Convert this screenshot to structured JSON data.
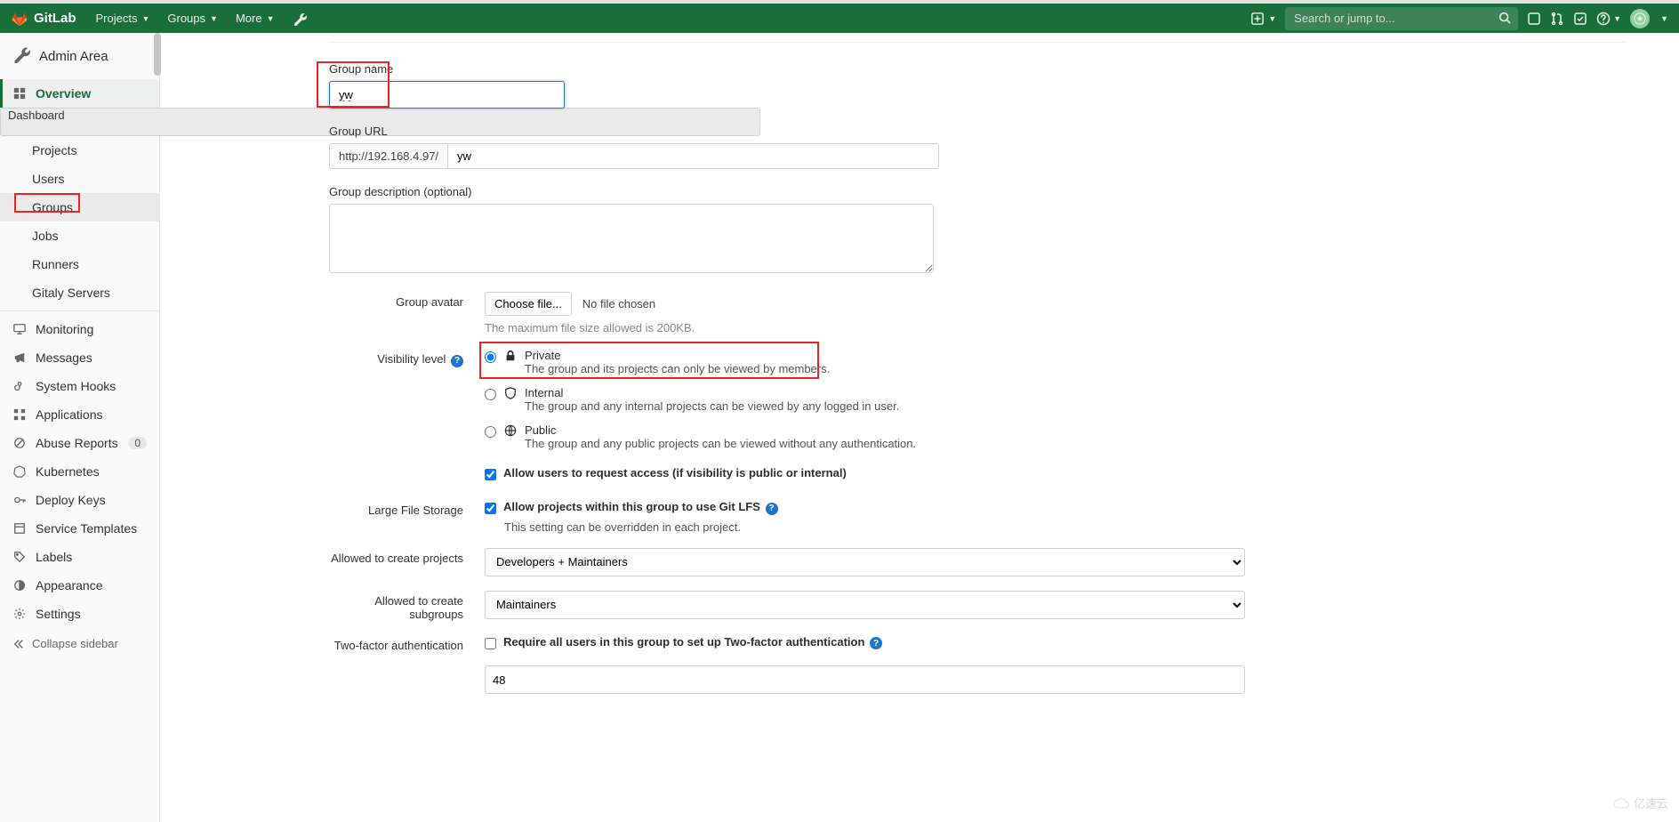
{
  "header": {
    "brand": "GitLab",
    "nav": {
      "projects": "Projects",
      "groups": "Groups",
      "more": "More"
    },
    "search_placeholder": "Search or jump to..."
  },
  "sidebar": {
    "title": "Admin Area",
    "overview": {
      "label": "Overview",
      "subs": {
        "dashboard": "Dashboard",
        "projects": "Projects",
        "users": "Users",
        "groups": "Groups",
        "jobs": "Jobs",
        "runners": "Runners",
        "gitaly": "Gitaly Servers"
      }
    },
    "items": {
      "monitoring": "Monitoring",
      "messages": "Messages",
      "system_hooks": "System Hooks",
      "applications": "Applications",
      "abuse_reports": "Abuse Reports",
      "abuse_count": "0",
      "kubernetes": "Kubernetes",
      "deploy_keys": "Deploy Keys",
      "service_templates": "Service Templates",
      "labels": "Labels",
      "appearance": "Appearance",
      "settings": "Settings"
    },
    "collapse": "Collapse sidebar"
  },
  "form": {
    "group_name_label": "Group name",
    "group_name_value": "yw",
    "group_url_label": "Group URL",
    "group_url_prefix": "http://192.168.4.97/",
    "group_url_value": "yw",
    "desc_label": "Group description (optional)",
    "avatar": {
      "label": "Group avatar",
      "button": "Choose file...",
      "none": "No file chosen",
      "hint": "The maximum file size allowed is 200KB."
    },
    "visibility": {
      "label": "Visibility level",
      "private": {
        "title": "Private",
        "desc": "The group and its projects can only be viewed by members."
      },
      "internal": {
        "title": "Internal",
        "desc": "The group and any internal projects can be viewed by any logged in user."
      },
      "public": {
        "title": "Public",
        "desc": "The group and any public projects can be viewed without any authentication."
      },
      "allow_access": "Allow users to request access (if visibility is public or internal)"
    },
    "lfs": {
      "label": "Large File Storage",
      "check": "Allow projects within this group to use Git LFS",
      "hint": "This setting can be overridden in each project."
    },
    "allowed_projects": {
      "label": "Allowed to create projects",
      "value": "Developers + Maintainers"
    },
    "allowed_subgroups": {
      "label": "Allowed to create subgroups",
      "value": "Maintainers"
    },
    "twofa": {
      "label": "Two-factor authentication",
      "check": "Require all users in this group to set up Two-factor authentication",
      "value": "48"
    }
  },
  "watermark": "亿速云"
}
